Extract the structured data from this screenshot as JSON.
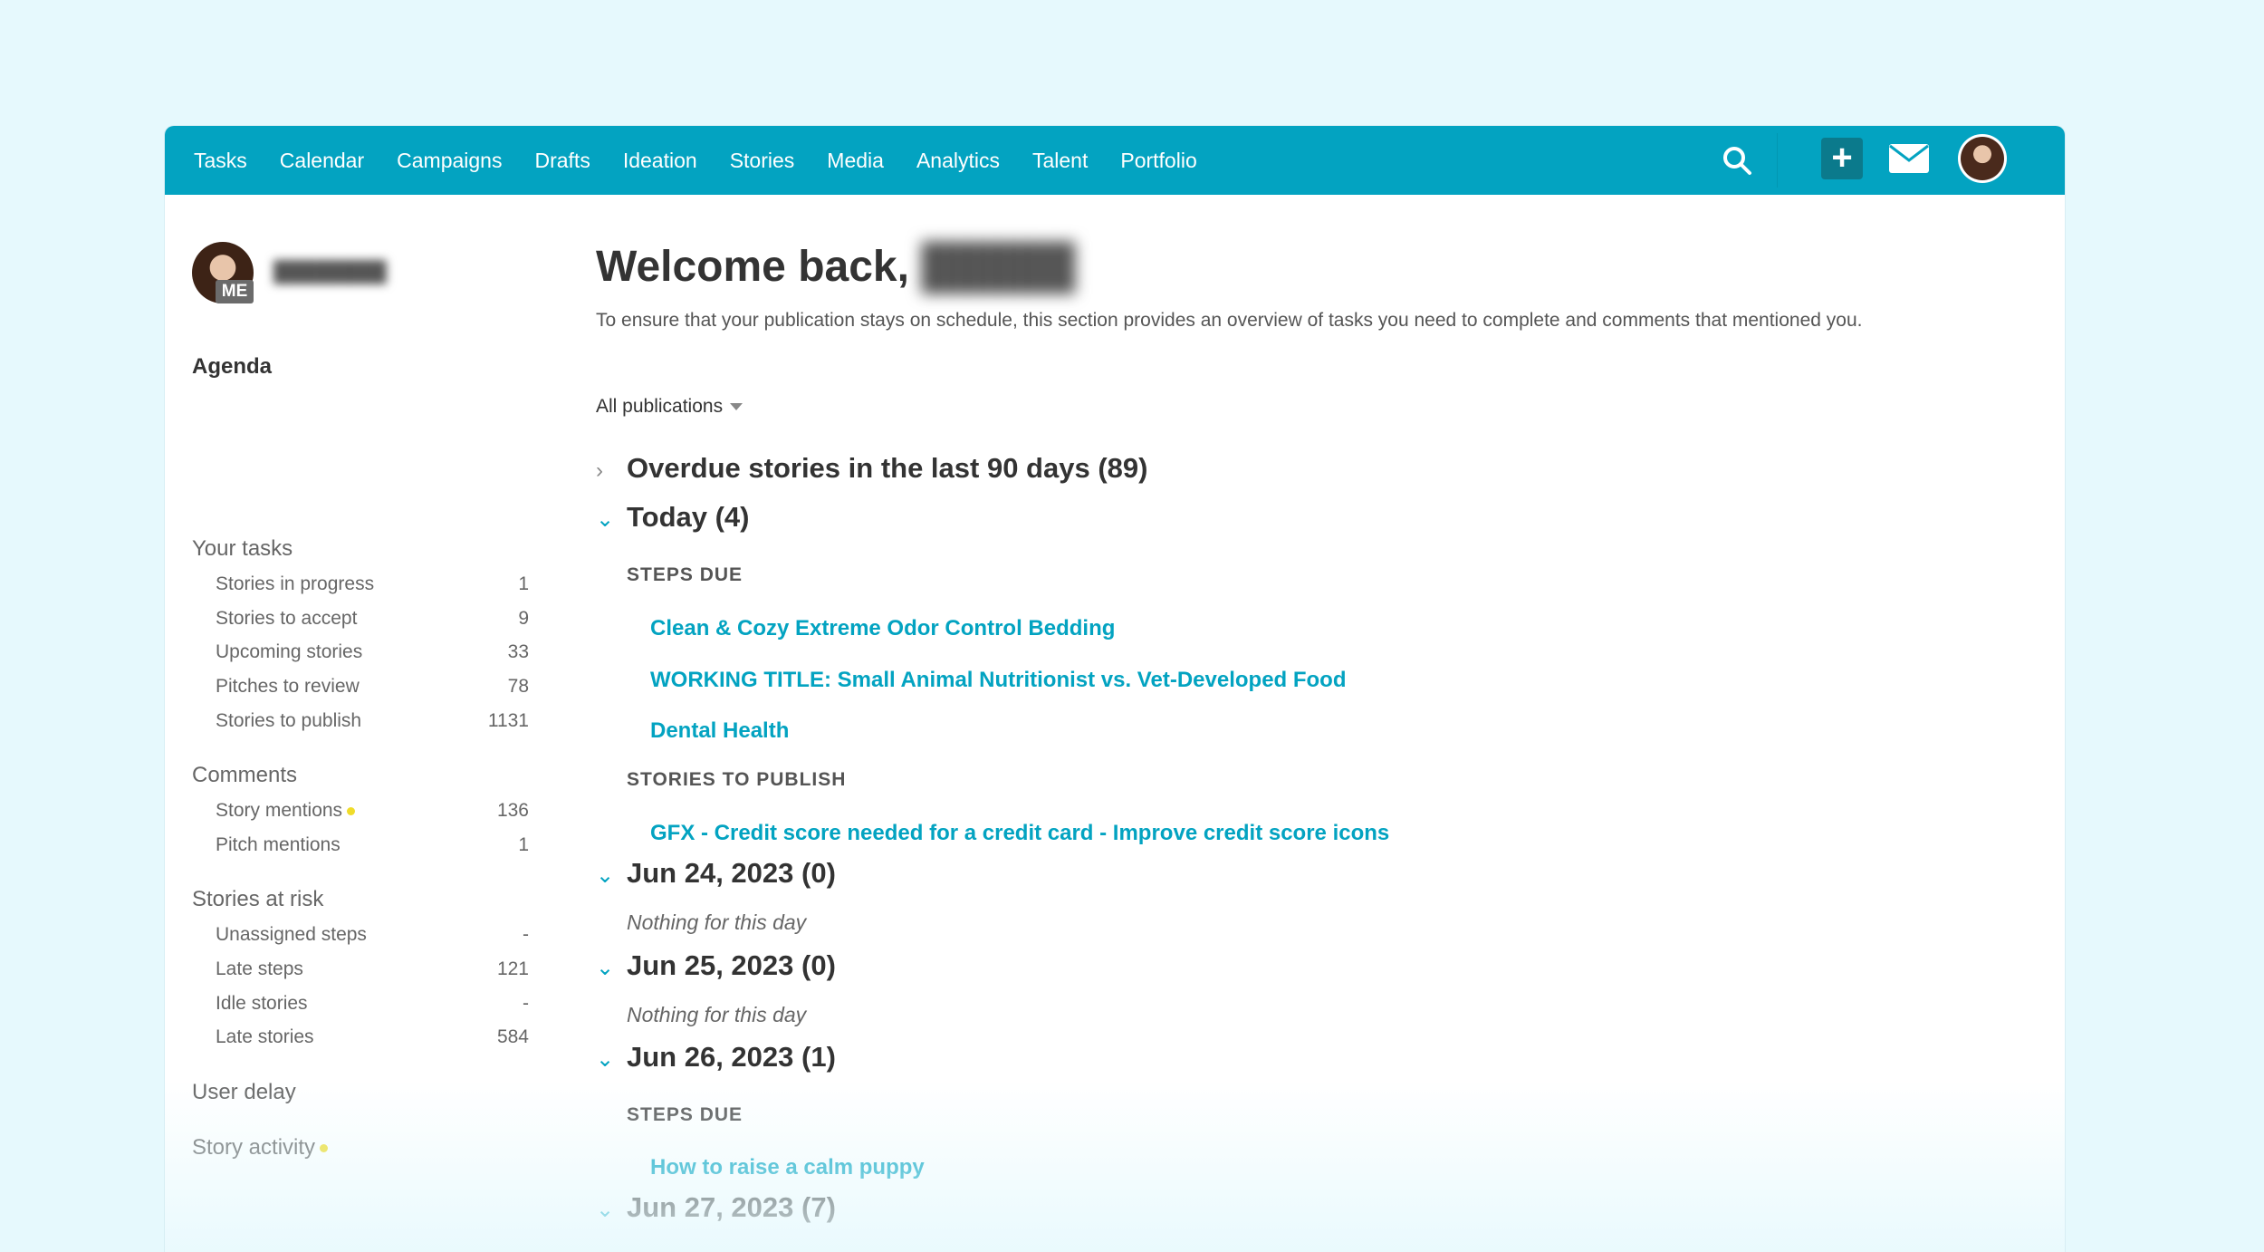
{
  "nav": {
    "items": [
      "Tasks",
      "Calendar",
      "Campaigns",
      "Drafts",
      "Ideation",
      "Stories",
      "Media",
      "Analytics",
      "Talent",
      "Portfolio"
    ],
    "icons": [
      "search-icon",
      "plus-icon",
      "mail-icon",
      "user-avatar"
    ]
  },
  "sidebar": {
    "me_badge": "ME",
    "agenda_label": "Agenda",
    "your_tasks": {
      "title": "Your tasks",
      "items": [
        {
          "label": "Stories in progress",
          "count": "1"
        },
        {
          "label": "Stories to accept",
          "count": "9"
        },
        {
          "label": "Upcoming stories",
          "count": "33"
        },
        {
          "label": "Pitches to review",
          "count": "78"
        },
        {
          "label": "Stories to publish",
          "count": "1131"
        }
      ]
    },
    "comments": {
      "title": "Comments",
      "items": [
        {
          "label": "Story mentions",
          "count": "136"
        },
        {
          "label": "Pitch mentions",
          "count": "1"
        }
      ]
    },
    "at_risk": {
      "title": "Stories at risk",
      "items": [
        {
          "label": "Unassigned steps",
          "count": "-"
        },
        {
          "label": "Late steps",
          "count": "121"
        },
        {
          "label": "Idle stories",
          "count": "-"
        },
        {
          "label": "Late stories",
          "count": "584"
        }
      ]
    },
    "user_delay": "User delay",
    "story_activity": "Story activity"
  },
  "main": {
    "welcome": "Welcome back,",
    "intro": "To ensure that your publication stays on schedule, this section provides an overview of tasks you need to complete and comments that mentioned you.",
    "filter": "All publications",
    "groups": {
      "overdue": "Overdue stories in the last 90 days (89)",
      "today": "Today (4)",
      "jun24": "Jun 24, 2023 (0)",
      "jun25": "Jun 25, 2023 (0)",
      "jun26": "Jun 26, 2023 (1)",
      "jun27": "Jun 27, 2023 (7)"
    },
    "steps_due": "STEPS DUE",
    "stories_to_publish": "STORIES TO PUBLISH",
    "nothing": "Nothing for this day",
    "today_links": [
      "Clean & Cozy Extreme Odor Control Bedding",
      "WORKING TITLE: Small Animal Nutritionist vs. Vet-Developed Food",
      "Dental Health"
    ],
    "today_publish_links": [
      "GFX - Credit score needed for a credit card - Improve credit score icons"
    ],
    "jun26_links": [
      "How to raise a calm puppy"
    ]
  },
  "colors": {
    "accent": "#03a3c1",
    "accent_dark": "#0b7a8c",
    "background": "#e6f9fd",
    "dot": "#f0dc2a"
  }
}
